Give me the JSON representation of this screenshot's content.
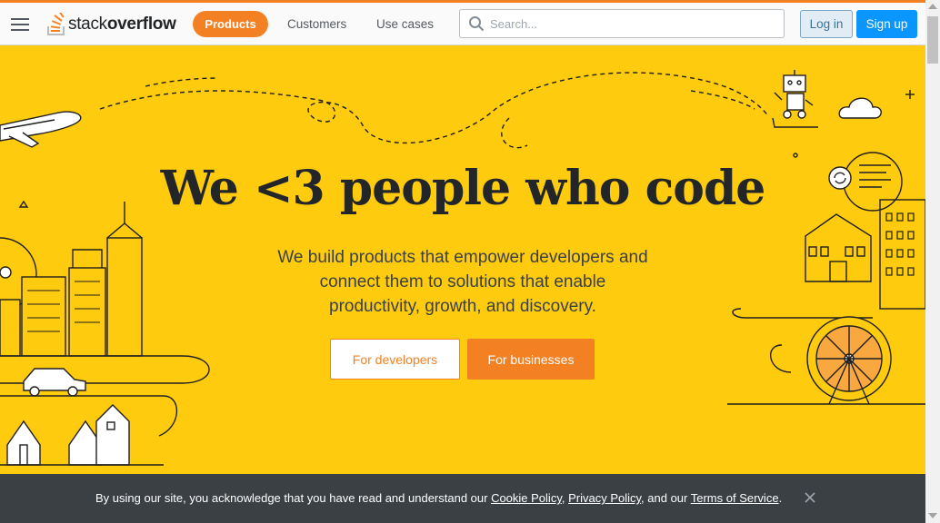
{
  "header": {
    "logo_text_light": "stack",
    "logo_text_bold": "overflow",
    "nav": [
      {
        "label": "Products",
        "active": true
      },
      {
        "label": "Customers"
      },
      {
        "label": "Use cases"
      }
    ],
    "search_placeholder": "Search...",
    "login_label": "Log in",
    "signup_label": "Sign up"
  },
  "hero": {
    "title": "We <3 people who code",
    "subtitle": "We build products that empower developers and connect them to solutions that enable productivity, growth, and discovery.",
    "btn_developers": "For developers",
    "btn_businesses": "For businesses"
  },
  "cookie": {
    "prefix": "By using our site, you acknowledge that you have read and understand our ",
    "cookie_policy": "Cookie Policy",
    "sep1": ", ",
    "privacy_policy": "Privacy Policy",
    "sep2": ", and our ",
    "terms": "Terms of Service",
    "suffix": "."
  },
  "colors": {
    "brand_orange": "#f48024",
    "hero_yellow": "#ffcb0f",
    "signup_blue": "#0a95ff",
    "banner_dark": "#3b4045"
  },
  "icons": [
    "hamburger-icon",
    "stackoverflow-logo-icon",
    "search-icon",
    "close-icon"
  ]
}
